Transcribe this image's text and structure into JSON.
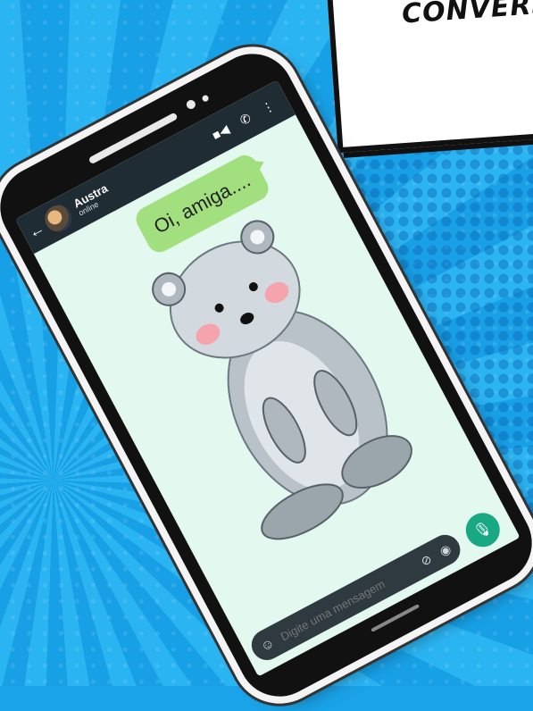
{
  "banner": {
    "text": "CONVERSA"
  },
  "chat": {
    "contact_name": "Austra",
    "contact_status": "online",
    "message": "Oi, amiga...."
  },
  "input": {
    "placeholder": "Digite uma mensagem"
  },
  "icons": {
    "back": "back-arrow-icon",
    "video": "video-call-icon",
    "phone": "phone-call-icon",
    "menu": "more-vert-icon",
    "emoji": "emoji-icon",
    "attach": "attach-icon",
    "camera": "camera-icon",
    "mic": "mic-icon"
  },
  "colors": {
    "header": "#1f2c34",
    "bubble": "#a2e07f",
    "chat_bg": "#e3f8ef",
    "mic_button": "#18a884",
    "background": "#1aa3e8"
  }
}
